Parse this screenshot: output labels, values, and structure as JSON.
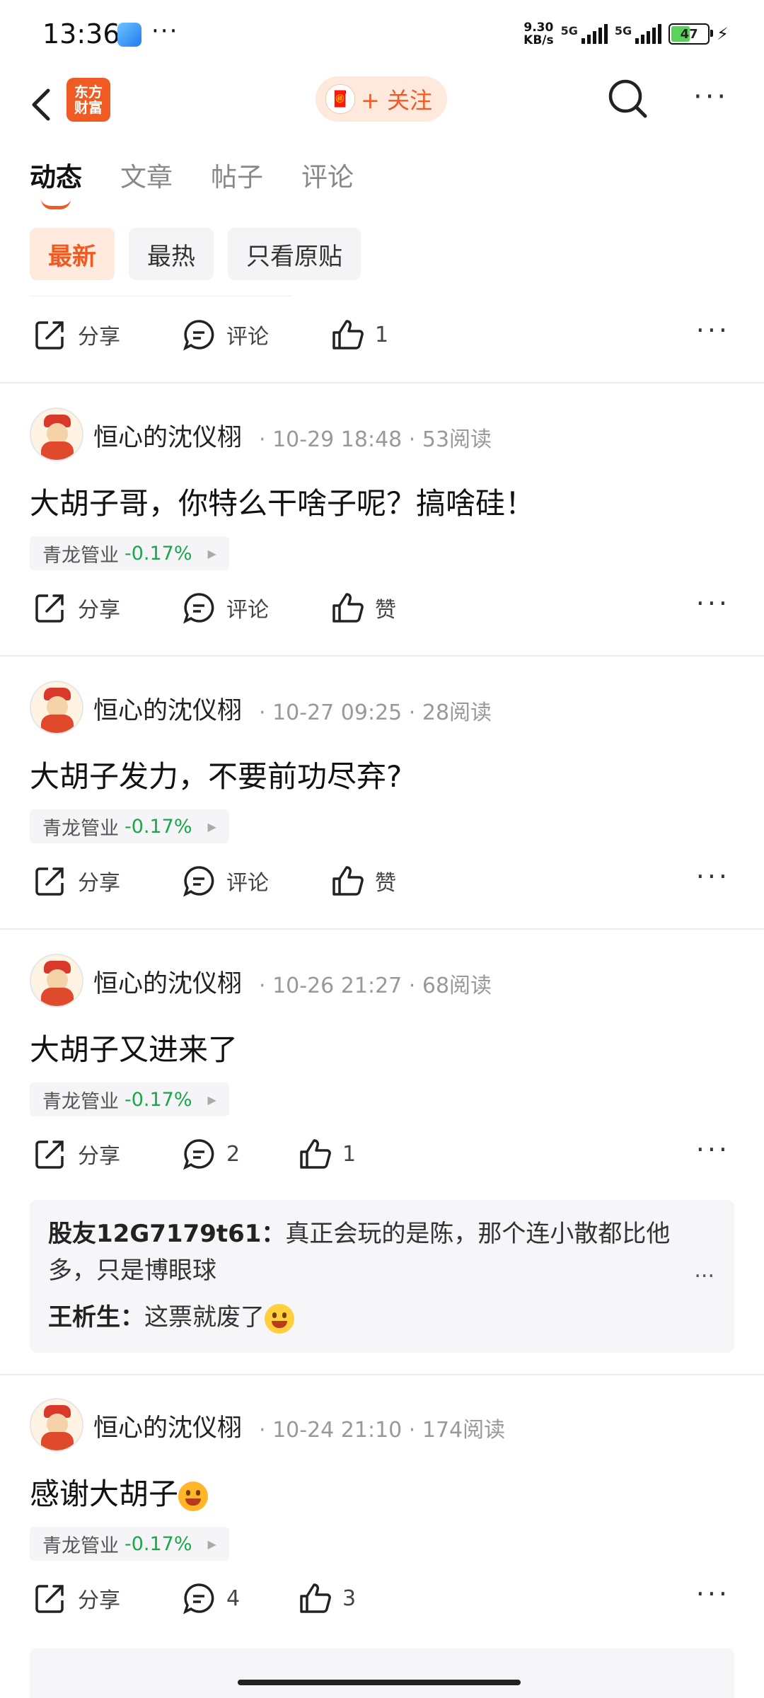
{
  "status": {
    "time": "13:36",
    "net_speed_top": "9.30",
    "net_speed_bottom": "KB/s",
    "sig1": "5G",
    "sig2": "5G",
    "battery": "47"
  },
  "nav": {
    "logo_line1": "东方",
    "logo_line2": "财富",
    "follow_label": "+ 关注"
  },
  "tabs": [
    "动态",
    "文章",
    "帖子",
    "评论"
  ],
  "filters": [
    "最新",
    "最热",
    "只看原贴"
  ],
  "labels": {
    "share": "分享",
    "comment": "评论",
    "like": "赞"
  },
  "top_actions": {
    "share": "分享",
    "comment": "评论",
    "like": "1"
  },
  "posts": [
    {
      "author": "恒心的沈仪栩",
      "time": "10-29 18:48",
      "reads": "53阅读",
      "content": "大胡子哥，你特么干啥子呢？搞啥硅！",
      "stock_name": "青龙管业",
      "stock_change": "-0.17%",
      "comment": "评论",
      "like": "赞"
    },
    {
      "author": "恒心的沈仪栩",
      "time": "10-27 09:25",
      "reads": "28阅读",
      "content": "大胡子发力，不要前功尽弃?",
      "stock_name": "青龙管业",
      "stock_change": "-0.17%",
      "comment": "评论",
      "like": "赞"
    },
    {
      "author": "恒心的沈仪栩",
      "time": "10-26 21:27",
      "reads": "68阅读",
      "content": "大胡子又进来了",
      "stock_name": "青龙管业",
      "stock_change": "-0.17%",
      "comment": "2",
      "like": "1",
      "comments": [
        {
          "user": "股友12G7179t61",
          "text": "真正会玩的是陈，那个连小散都比他多，只是博眼球"
        },
        {
          "user": "王析生",
          "text": "这票就废了"
        }
      ],
      "comments_more": "..."
    },
    {
      "author": "恒心的沈仪栩",
      "time": "10-24 21:10",
      "reads": "174阅读",
      "content": "感谢大胡子",
      "stock_name": "青龙管业",
      "stock_change": "-0.17%",
      "comment": "4",
      "like": "3"
    }
  ],
  "colors": {
    "accent": "#f05a23",
    "stock_down": "#1aa64a"
  }
}
